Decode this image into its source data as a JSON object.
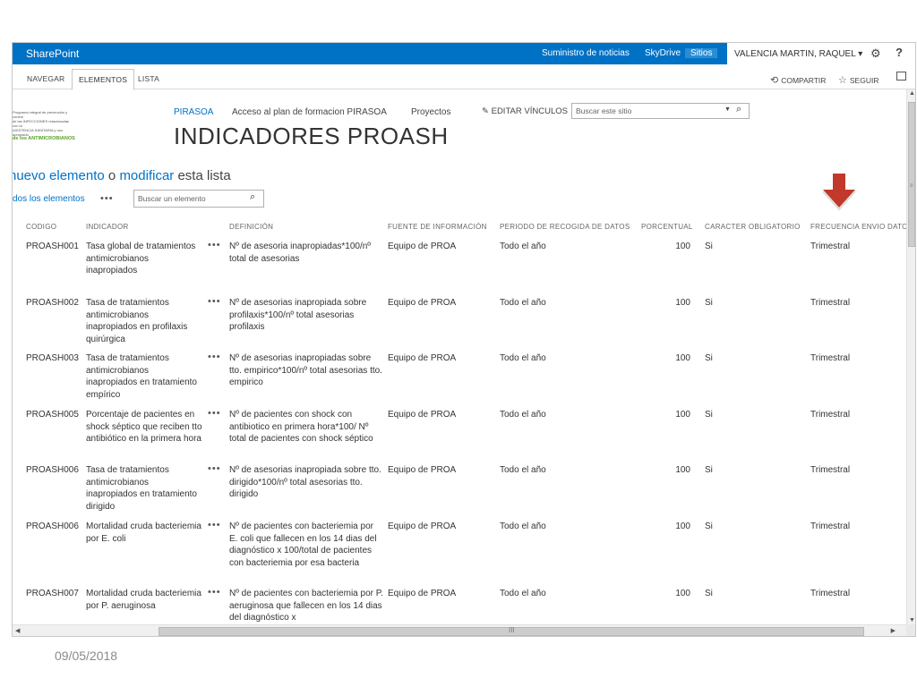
{
  "suitebar": {
    "brand": "SharePoint",
    "links": [
      "Suministro de noticias",
      "SkyDrive",
      "Sitios"
    ],
    "user": "VALENCIA MARTIN, RAQUEL",
    "user_caret": "▾",
    "settings_glyph": "⚙",
    "help_glyph": "?"
  },
  "ribbon": {
    "tabs": [
      "NAVEGAR",
      "ELEMENTOS",
      "LISTA"
    ],
    "share": "COMPARTIR",
    "follow": "SEGUIR",
    "share_glyph": "⟲",
    "follow_glyph": "☆"
  },
  "site": {
    "logo_lines": [
      "Programa integral de prevención y control",
      "de las INFECCIONES relacionadas con la",
      "ASISTENCIA SANITARIA y uso apropiado",
      "de los ANTIMICROBIANOS"
    ],
    "nav": [
      "PIRASOA",
      "Acceso al plan de formacion PIRASOA",
      "Proyectos"
    ],
    "edit_glyph": "✎",
    "edit_links": "EDITAR VÍNCULOS",
    "search_placeholder": "Buscar este sitio",
    "search_caret": "▼",
    "search_glyph": "⌕",
    "title": "INDICADORES PROASH"
  },
  "list": {
    "new_item_prefix": "nuevo elemento",
    "new_item_mid": "o",
    "new_item_link2": "modificar",
    "new_item_suffix": "esta lista",
    "view": "dos los elementos",
    "ellipsis": "•••",
    "search_placeholder": "Buscar un elemento",
    "search_glyph": "⌕",
    "columns": [
      "CODIGO",
      "INDICADOR",
      "DEFINICIÓN",
      "FUENTE DE INFORMACIÓN",
      "PERIODO DE RECOGIDA DE DATOS",
      "PORCENTUAL",
      "CARACTER OBLIGATORIO",
      "FRECUENCIA ENVIO DATOS"
    ],
    "rows": [
      {
        "codigo": "PROASH001",
        "indicador": "Tasa global de tratamientos antimicrobianos inapropiados",
        "definicion": "Nº de asesoria inapropiadas*100/nº total de asesorias",
        "fuente": "Equipo de PROA",
        "periodo": "Todo el año",
        "porcentual": "100",
        "caracter": "Si",
        "frecuencia": "Trimestral"
      },
      {
        "codigo": "PROASH002",
        "indicador": "Tasa de tratamientos antimicrobianos inapropiados en profilaxis quirúrgica",
        "definicion": "Nº de asesorias inapropiada sobre profilaxis*100/nº total asesorias profilaxis",
        "fuente": "Equipo de PROA",
        "periodo": "Todo el año",
        "porcentual": "100",
        "caracter": "Si",
        "frecuencia": "Trimestral"
      },
      {
        "codigo": "PROASH003",
        "indicador": "Tasa de tratamientos antimicrobianos inapropiados en tratamiento empírico",
        "definicion": "Nº de asesorias inapropiadas sobre tto. empirico*100/nº total asesorias tto. empirico",
        "fuente": "Equipo de PROA",
        "periodo": "Todo el año",
        "porcentual": "100",
        "caracter": "Si",
        "frecuencia": "Trimestral"
      },
      {
        "codigo": "PROASH005",
        "indicador": "Porcentaje de pacientes en shock séptico que reciben tto antibiótico en la primera hora",
        "definicion": "Nº de pacientes con shock con antibiotico en primera hora*100/ Nº total de pacientes con shock séptico",
        "fuente": "Equipo de PROA",
        "periodo": "Todo el año",
        "porcentual": "100",
        "caracter": "Si",
        "frecuencia": "Trimestral"
      },
      {
        "codigo": "PROASH006",
        "indicador": "Tasa de tratamientos antimicrobianos inapropiados en tratamiento dirigido",
        "definicion": "Nº de asesorias inapropiada sobre tto. dirigido*100/nº total asesorias tto. dirigido",
        "fuente": "Equipo de PROA",
        "periodo": "Todo el año",
        "porcentual": "100",
        "caracter": "Si",
        "frecuencia": "Trimestral"
      },
      {
        "codigo": "PROASH006",
        "indicador": "Mortalidad cruda bacteriemia por E. coli",
        "definicion": "Nº de pacientes con bacteriemia por E. coli que fallecen en los 14 dias del diagnóstico x 100/total de pacientes con bacteriemia por esa bacteria",
        "fuente": "Equipo de PROA",
        "periodo": "Todo el año",
        "porcentual": "100",
        "caracter": "Si",
        "frecuencia": "Trimestral"
      },
      {
        "codigo": "PROASH007",
        "indicador": "Mortalidad cruda bacteriemia por P. aeruginosa",
        "definicion": "Nº de pacientes con bacteriemia por P. aeruginosa que fallecen en los 14 dias del diagnóstico x",
        "fuente": "Equipo de PROA",
        "periodo": "Todo el año",
        "porcentual": "100",
        "caracter": "Si",
        "frecuencia": "Trimestral"
      }
    ]
  },
  "scrollbar": {
    "up": "▲",
    "down": "▼",
    "left": "◀",
    "right": "▶",
    "grip_v": "≡",
    "grip_h": "III"
  },
  "footer": {
    "date": "09/05/2018"
  },
  "colors": {
    "suitebar": "#0072c6",
    "link": "#0072c6",
    "arrow": "#c0392b"
  }
}
